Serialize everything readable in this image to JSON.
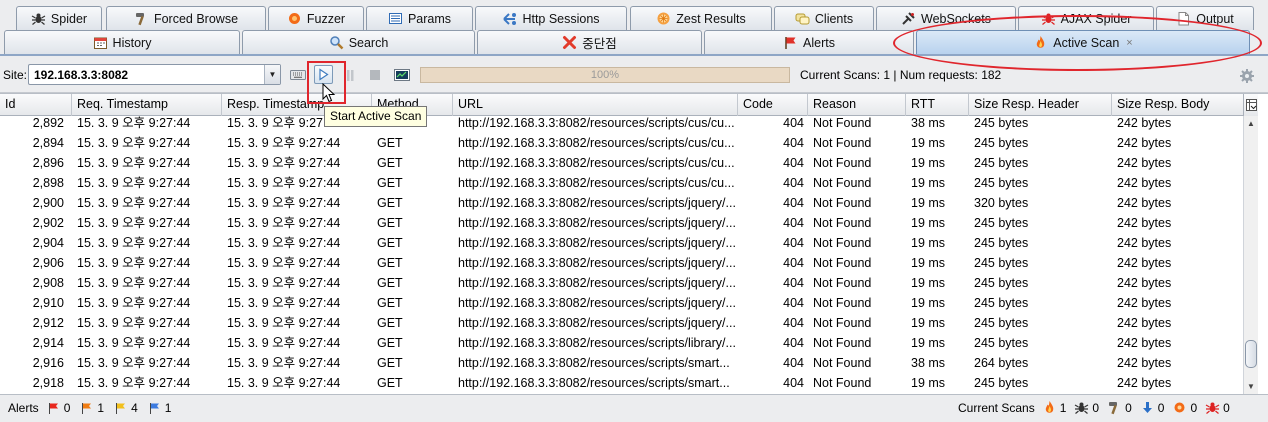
{
  "tabs_row1": [
    {
      "label": "Spider",
      "icon": "spider-icon"
    },
    {
      "label": "Forced Browse",
      "icon": "hammer-icon"
    },
    {
      "label": "Fuzzer",
      "icon": "fuzzer-icon"
    },
    {
      "label": "Params",
      "icon": "params-icon"
    },
    {
      "label": "Http Sessions",
      "icon": "sessions-icon"
    },
    {
      "label": "Zest Results",
      "icon": "zest-icon"
    },
    {
      "label": "Clients",
      "icon": "clients-icon"
    },
    {
      "label": "WebSockets",
      "icon": "websockets-icon"
    },
    {
      "label": "AJAX Spider",
      "icon": "ajax-spider-icon"
    },
    {
      "label": "Output",
      "icon": "output-icon"
    }
  ],
  "tabs_row2": [
    {
      "label": "History",
      "icon": "calendar-icon"
    },
    {
      "label": "Search",
      "icon": "search-icon"
    },
    {
      "label": "중단점",
      "icon": "breakpoint-x-icon"
    },
    {
      "label": "Alerts",
      "icon": "flag-icon"
    },
    {
      "label": "Active Scan",
      "icon": "flame-icon",
      "active": true,
      "close": "×"
    }
  ],
  "toolbar": {
    "site_label": "Site:",
    "site_value": "192.168.3.3:8082",
    "progress_text": "100%",
    "progress_value": 1.0,
    "scan_info": "Current Scans: 1 | Num requests: 182",
    "tooltip": "Start Active Scan"
  },
  "table": {
    "columns": [
      "Id",
      "Req. Timestamp",
      "Resp. Timestamp",
      "Method",
      "URL",
      "Code",
      "Reason",
      "RTT",
      "Size Resp. Header",
      "Size Resp. Body"
    ],
    "rows": [
      [
        "2,892",
        "15. 3. 9 오후 9:27:44",
        "15. 3. 9 오후 9:27:44",
        "GET",
        "http://192.168.3.3:8082/resources/scripts/cus/cu...",
        "404",
        "Not Found",
        "38 ms",
        "245 bytes",
        "242 bytes"
      ],
      [
        "2,894",
        "15. 3. 9 오후 9:27:44",
        "15. 3. 9 오후 9:27:44",
        "GET",
        "http://192.168.3.3:8082/resources/scripts/cus/cu...",
        "404",
        "Not Found",
        "19 ms",
        "245 bytes",
        "242 bytes"
      ],
      [
        "2,896",
        "15. 3. 9 오후 9:27:44",
        "15. 3. 9 오후 9:27:44",
        "GET",
        "http://192.168.3.3:8082/resources/scripts/cus/cu...",
        "404",
        "Not Found",
        "19 ms",
        "245 bytes",
        "242 bytes"
      ],
      [
        "2,898",
        "15. 3. 9 오후 9:27:44",
        "15. 3. 9 오후 9:27:44",
        "GET",
        "http://192.168.3.3:8082/resources/scripts/cus/cu...",
        "404",
        "Not Found",
        "19 ms",
        "245 bytes",
        "242 bytes"
      ],
      [
        "2,900",
        "15. 3. 9 오후 9:27:44",
        "15. 3. 9 오후 9:27:44",
        "GET",
        "http://192.168.3.3:8082/resources/scripts/jquery/...",
        "404",
        "Not Found",
        "19 ms",
        "320 bytes",
        "242 bytes"
      ],
      [
        "2,902",
        "15. 3. 9 오후 9:27:44",
        "15. 3. 9 오후 9:27:44",
        "GET",
        "http://192.168.3.3:8082/resources/scripts/jquery/...",
        "404",
        "Not Found",
        "19 ms",
        "245 bytes",
        "242 bytes"
      ],
      [
        "2,904",
        "15. 3. 9 오후 9:27:44",
        "15. 3. 9 오후 9:27:44",
        "GET",
        "http://192.168.3.3:8082/resources/scripts/jquery/...",
        "404",
        "Not Found",
        "19 ms",
        "245 bytes",
        "242 bytes"
      ],
      [
        "2,906",
        "15. 3. 9 오후 9:27:44",
        "15. 3. 9 오후 9:27:44",
        "GET",
        "http://192.168.3.3:8082/resources/scripts/jquery/...",
        "404",
        "Not Found",
        "19 ms",
        "245 bytes",
        "242 bytes"
      ],
      [
        "2,908",
        "15. 3. 9 오후 9:27:44",
        "15. 3. 9 오후 9:27:44",
        "GET",
        "http://192.168.3.3:8082/resources/scripts/jquery/...",
        "404",
        "Not Found",
        "19 ms",
        "245 bytes",
        "242 bytes"
      ],
      [
        "2,910",
        "15. 3. 9 오후 9:27:44",
        "15. 3. 9 오후 9:27:44",
        "GET",
        "http://192.168.3.3:8082/resources/scripts/jquery/...",
        "404",
        "Not Found",
        "19 ms",
        "245 bytes",
        "242 bytes"
      ],
      [
        "2,912",
        "15. 3. 9 오후 9:27:44",
        "15. 3. 9 오후 9:27:44",
        "GET",
        "http://192.168.3.3:8082/resources/scripts/jquery/...",
        "404",
        "Not Found",
        "19 ms",
        "245 bytes",
        "242 bytes"
      ],
      [
        "2,914",
        "15. 3. 9 오후 9:27:44",
        "15. 3. 9 오후 9:27:44",
        "GET",
        "http://192.168.3.3:8082/resources/scripts/library/...",
        "404",
        "Not Found",
        "19 ms",
        "245 bytes",
        "242 bytes"
      ],
      [
        "2,916",
        "15. 3. 9 오후 9:27:44",
        "15. 3. 9 오후 9:27:44",
        "GET",
        "http://192.168.3.3:8082/resources/scripts/smart...",
        "404",
        "Not Found",
        "38 ms",
        "264 bytes",
        "242 bytes"
      ],
      [
        "2,918",
        "15. 3. 9 오후 9:27:44",
        "15. 3. 9 오후 9:27:44",
        "GET",
        "http://192.168.3.3:8082/resources/scripts/smart...",
        "404",
        "Not Found",
        "19 ms",
        "245 bytes",
        "242 bytes"
      ]
    ]
  },
  "statusbar": {
    "alerts_label": "Alerts",
    "alert_counts": [
      {
        "icon": "high-alert-flag-icon",
        "color": "#e8271d",
        "count": "0"
      },
      {
        "icon": "medium-alert-flag-icon",
        "color": "#f07d14",
        "count": "1"
      },
      {
        "icon": "low-alert-flag-icon",
        "color": "#f2c01c",
        "count": "4"
      },
      {
        "icon": "info-alert-flag-icon",
        "color": "#3d7be0",
        "count": "1"
      }
    ],
    "current_scans_label": "Current Scans",
    "scan_counts": [
      {
        "icon": "active-scan-flame-icon",
        "count": "1"
      },
      {
        "icon": "spider-scan-icon",
        "count": "0"
      },
      {
        "icon": "forced-browse-scan-icon",
        "count": "0"
      },
      {
        "icon": "fuzzer-scan-icon",
        "count": "0"
      },
      {
        "icon": "ajax-scan-icon",
        "count": "0"
      },
      {
        "icon": "ajax-spider-scan-icon",
        "count": "0"
      }
    ]
  }
}
